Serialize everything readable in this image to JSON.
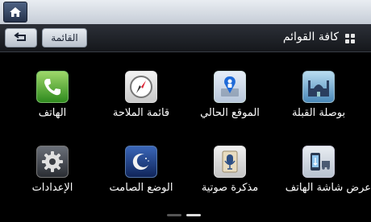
{
  "header": {
    "title": "كافة القوائم",
    "list_label": "القائمة"
  },
  "tiles": [
    {
      "label": "بوصلة القبلة",
      "icon": "mosque-icon"
    },
    {
      "label": "الموقع الحالي",
      "icon": "location-pin-icon"
    },
    {
      "label": "قائمة الملاحة",
      "icon": "compass-icon"
    },
    {
      "label": "الهاتف",
      "icon": "phone-icon"
    },
    {
      "label": "عرض شاشة الهاتف",
      "icon": "phone-screen-icon"
    },
    {
      "label": "مذكرة صوتية",
      "icon": "microphone-icon"
    },
    {
      "label": "الوضع الصامت",
      "icon": "moon-icon"
    },
    {
      "label": "الإعدادات",
      "icon": "gear-icon"
    }
  ],
  "pager": {
    "pages": 2,
    "current": 2
  }
}
